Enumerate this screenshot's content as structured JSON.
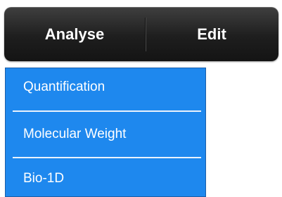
{
  "menubar": {
    "items": [
      {
        "label": "Analyse"
      },
      {
        "label": "Edit"
      }
    ]
  },
  "dropdown": {
    "items": [
      {
        "label": "Quantification"
      },
      {
        "label": "Molecular Weight"
      },
      {
        "label": "Bio-1D"
      }
    ]
  }
}
